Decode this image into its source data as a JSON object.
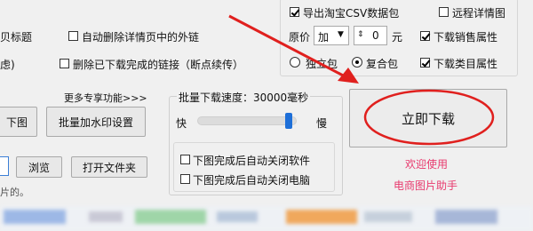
{
  "left_panel": {
    "cut_label_1": "贝标题",
    "auto_delete_links_label": "自动删除详情页中的外链",
    "auto_delete_links_checked": false,
    "cut_label_2": "虑)",
    "delete_downloaded_links_label": "删除已下载完成的链接（断点续传）",
    "delete_downloaded_links_checked": false,
    "more_features_link": "更多专享功能>>>",
    "download_image_button": "下图",
    "batch_watermark_button": "批量加水印设置",
    "browse_button": "浏览",
    "open_folder_button": "打开文件夹",
    "cut_label_3": "片的。"
  },
  "top_options": {
    "export_csv_label": "导出淘宝CSV数据包",
    "export_csv_checked": true,
    "remote_details_label": "远程详情图",
    "remote_details_checked": false,
    "price_label": "原价",
    "price_operator": "加",
    "price_value": "0",
    "price_unit": "元",
    "download_sales_attr_label": "下载销售属性",
    "download_sales_attr_checked": true,
    "independent_package_label": "独立包",
    "composite_package_label": "复合包",
    "package_selected": "composite",
    "download_category_attr_label": "下载类目属性",
    "download_category_attr_checked": true
  },
  "speed_panel": {
    "title": "批量下载速度：30000毫秒",
    "fast_label": "快",
    "slow_label": "慢",
    "speed_level": 0.95,
    "close_software_label": "下图完成后自动关闭软件",
    "close_software_checked": false,
    "shutdown_label": "下图完成后自动关闭电脑",
    "shutdown_checked": false
  },
  "action": {
    "download_now_button": "立即下载",
    "welcome_line1": "欢迎使用",
    "welcome_line2": "电商图片助手"
  },
  "colors": {
    "annotation_red": "#e0201e",
    "welcome_pink": "#e83a6e"
  }
}
